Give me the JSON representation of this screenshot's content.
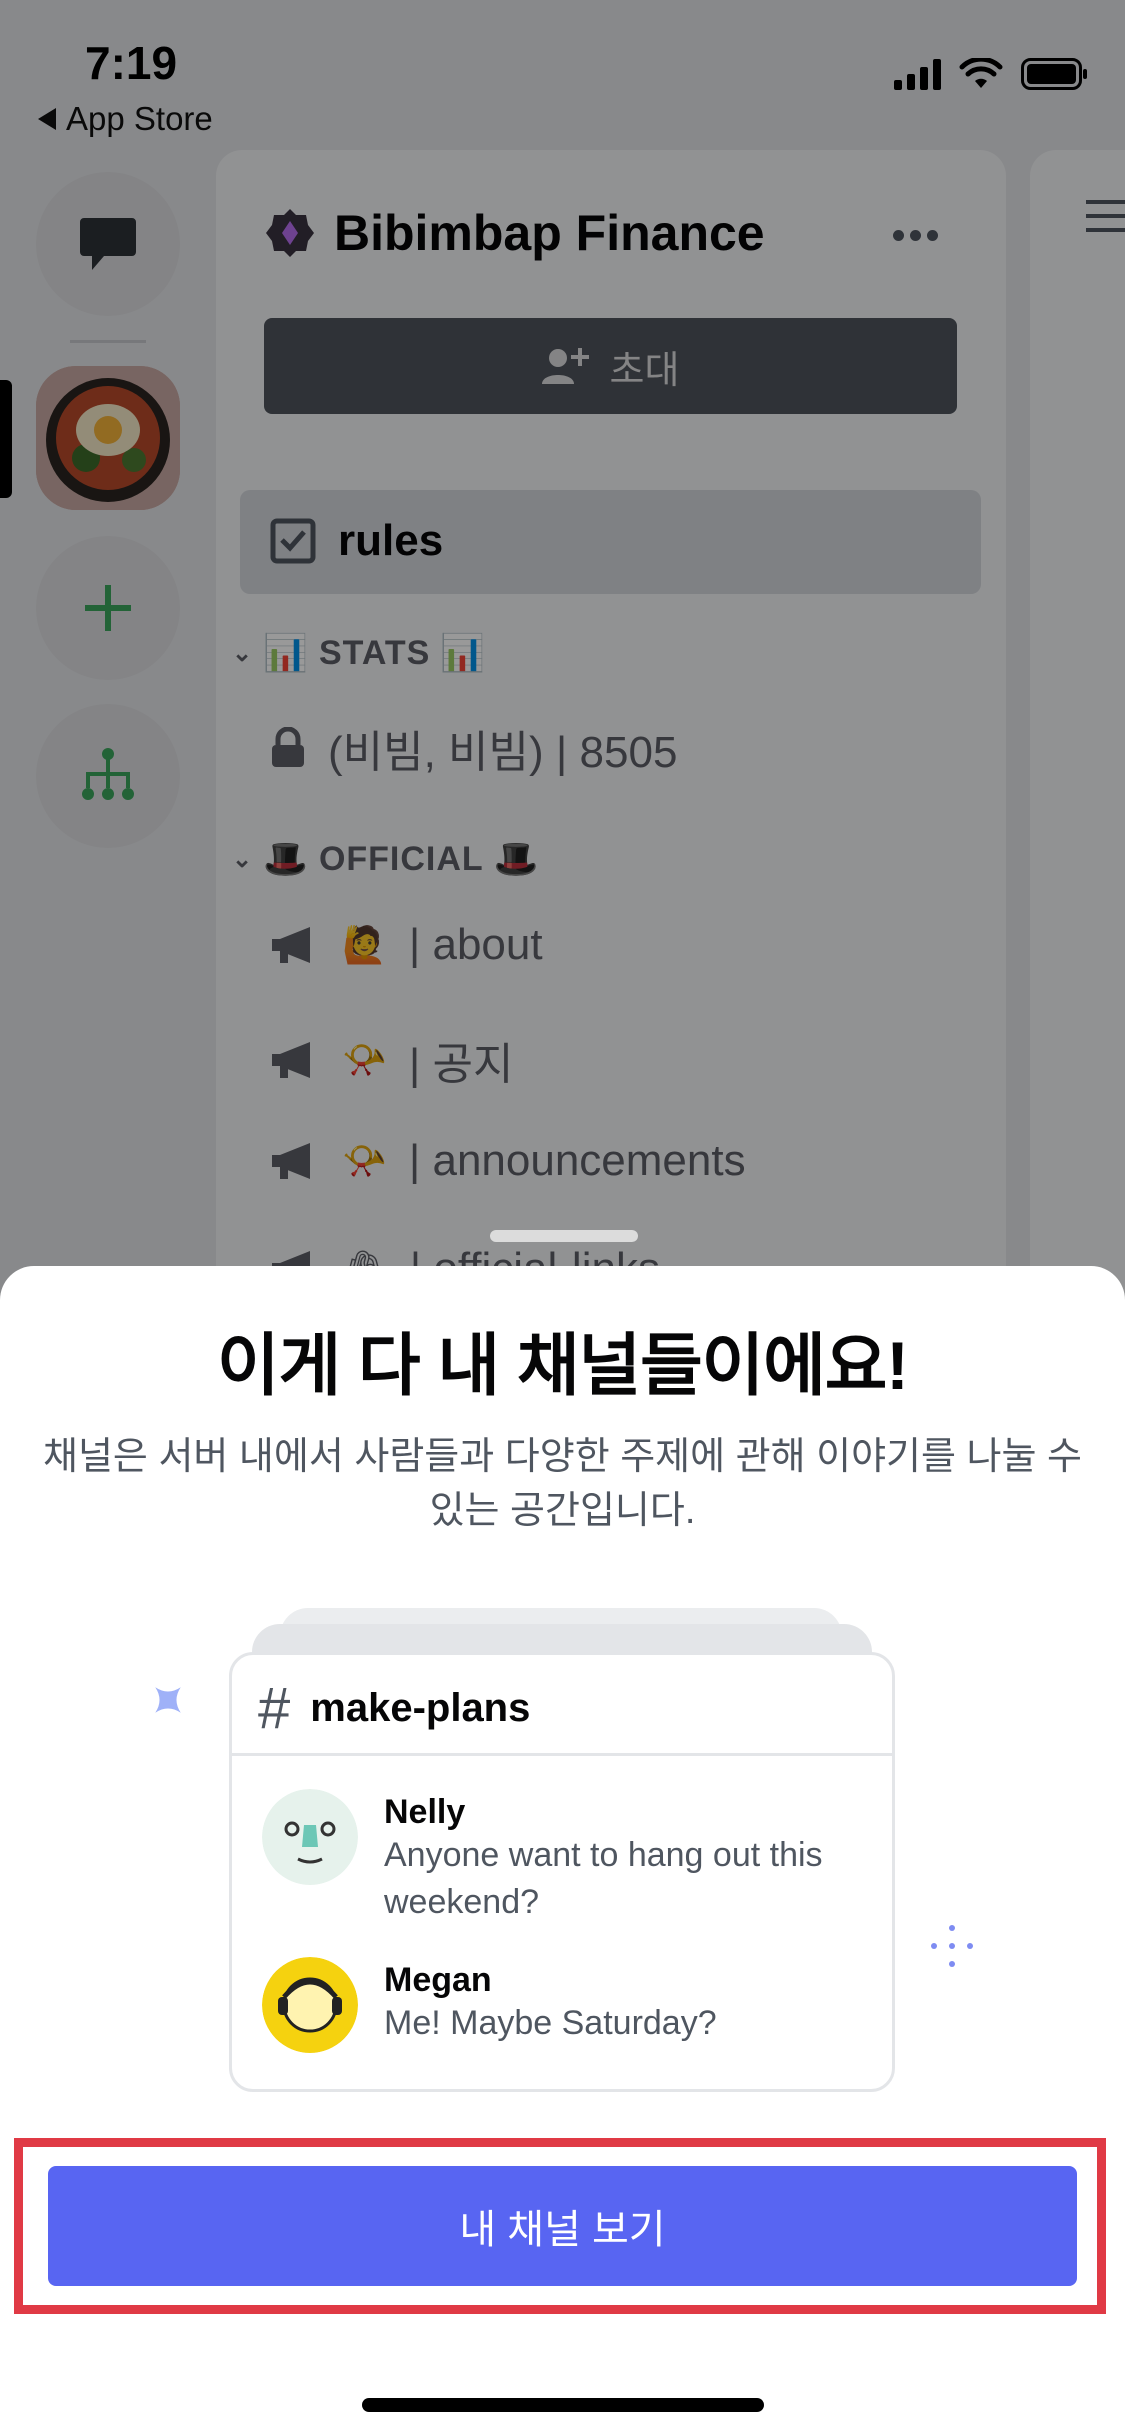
{
  "status_bar": {
    "time": "7:19",
    "back_label": "App Store"
  },
  "rail": {
    "dm_icon": "chat-bubble-icon",
    "add_icon": "plus-icon",
    "explore_icon": "hierarchy-icon"
  },
  "server": {
    "name": "Bibimbap Finance",
    "invite_label": "초대"
  },
  "channels": {
    "rules": "rules",
    "stats_category": "STATS",
    "stats_channel": "(비빔, 비빔) | 8505",
    "official_category": "OFFICIAL",
    "about": "| about",
    "notice": "| 공지",
    "announcements": "| announcements",
    "official_links": "| official-links"
  },
  "sheet": {
    "title": "이게 다 내 채널들이에요!",
    "description": "채널은 서버 내에서 사람들과 다양한 주제에 관해 이야기를 나눌 수 있는 공간입니다.",
    "card": {
      "channel_name": "make-plans",
      "messages": [
        {
          "author": "Nelly",
          "text": "Anyone want to hang out this weekend?"
        },
        {
          "author": "Megan",
          "text": "Me! Maybe Saturday?"
        }
      ]
    },
    "cta_label": "내 채널 보기"
  },
  "colors": {
    "brand": "#5865f2",
    "highlight_frame": "#e03a45"
  }
}
